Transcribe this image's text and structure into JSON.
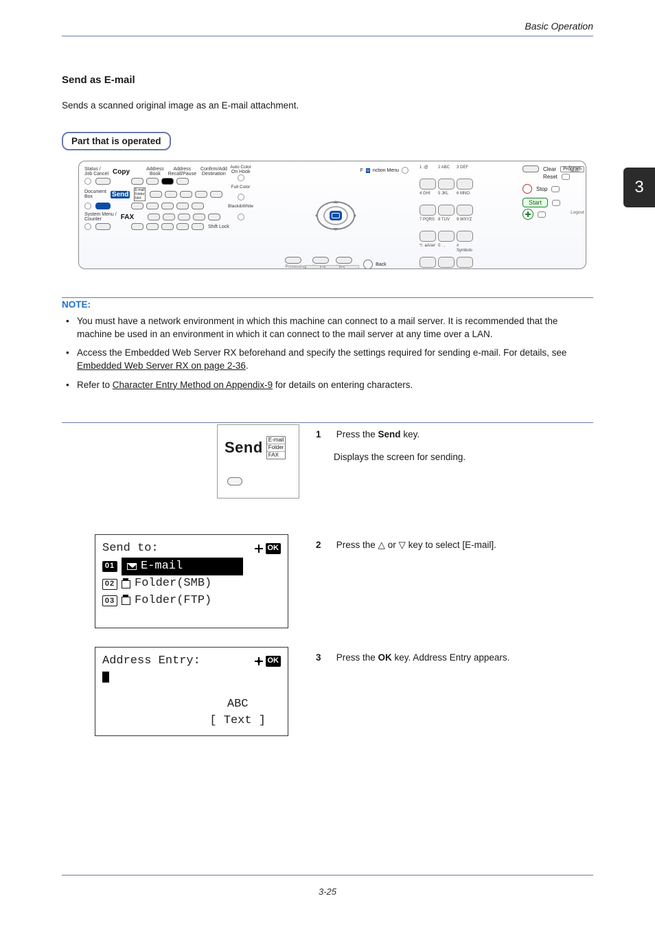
{
  "header": {
    "title": "Basic Operation"
  },
  "section": {
    "title": "Send as E-mail",
    "intro": "Sends a scanned original image as an E-mail attachment.",
    "pill": "Part that is operated"
  },
  "tab": {
    "number": "3"
  },
  "panel": {
    "left": {
      "status": "Status /\nJob Cancel",
      "copy": "Copy",
      "docbox": "Document\nBox",
      "send": "Send",
      "sendopts": {
        "a": "E-mail",
        "b": "Folder",
        "c": "FAX"
      },
      "system": "System Menu /\nCounter",
      "fax": "FAX",
      "topbtns": {
        "a": "Address\nBook",
        "b": "Address\nRecall/Pause",
        "c": "Confirm/Add\nDestination",
        "d": "On Hook"
      },
      "shift": "Shift Lock"
    },
    "colors": {
      "auto": "Auto Color",
      "full": "Full Color",
      "bw": "Black&White"
    },
    "center": {
      "fmenu_pre": "F",
      "fmenu_hl": "u",
      "fmenu_post": "nction Menu",
      "back": "Back",
      "led_a": "Processing",
      "led_b": "Memory",
      "led_c": "Attention"
    },
    "right": {
      "keys": [
        "1 .@",
        "2 ABC",
        "3 DEF",
        "4 GHI",
        "5 JKL",
        "6 MNO",
        "7 PQRS",
        "8 TUV",
        "9 WXYZ",
        "*/. aA/a#",
        "0 . ,",
        "# Symbols"
      ],
      "clear": "Clear",
      "reset": "Reset",
      "stop": "Stop",
      "start": "Start",
      "program": "Program",
      "logout": "Logout",
      "energy": "Energy\nSaver"
    }
  },
  "note": {
    "heading": "NOTE:",
    "items": [
      {
        "text_a": "You must have a network environment in which this machine can connect to a mail server. It is recommended that the machine be used in an environment in which it can connect to the mail server at any time over a LAN."
      },
      {
        "text_a": "Access the Embedded Web Server RX beforehand and specify the settings required for sending e-mail. For details, see ",
        "link": "Embedded Web Server RX on page 2-36",
        "text_b": "."
      },
      {
        "text_a": "Refer to ",
        "link": "Character Entry Method on Appendix-9",
        "text_b": " for details on entering characters."
      }
    ]
  },
  "sendbox": {
    "label": "Send",
    "opt1": "E-mail",
    "opt2": "Folder",
    "opt3": "FAX"
  },
  "lcd1": {
    "title": "Send to:",
    "ok": "OK",
    "n1": "01",
    "l1": "E-mail",
    "n2": "02",
    "l2": "Folder(SMB)",
    "n3": "03",
    "l3": "Folder(FTP)"
  },
  "lcd2": {
    "title": "Address Entry:",
    "ok": "OK",
    "abc": "ABC",
    "text": "[  Text  ]"
  },
  "steps": {
    "s1n": "1",
    "s1a": "Press the ",
    "s1b": "Send",
    "s1c": " key.",
    "s1d": "Displays the screen for sending.",
    "s2n": "2",
    "s2a": "Press the ",
    "up": "△",
    "s2b": " or ",
    "down": "▽",
    "s2c": " key to select [E-mail].",
    "s3n": "3",
    "s3a": "Press the ",
    "s3b": "OK",
    "s3c": " key. Address Entry appears."
  },
  "footer": {
    "page": "3-25"
  }
}
